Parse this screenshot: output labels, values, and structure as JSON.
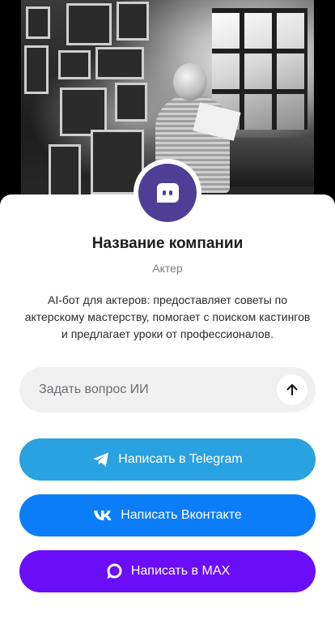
{
  "company": {
    "name": "Название компании",
    "category": "Актер",
    "description": "AI-бот для актеров: предоставляет советы по актерскому мастерству, помогает с поиском кастингов и предлагает уроки от профессионалов."
  },
  "ask": {
    "placeholder": "Задать вопрос ИИ",
    "value": ""
  },
  "buttons": {
    "telegram": "Написать в Telegram",
    "vkontakte": "Написать Вконтакте",
    "max": "Написать в MAX"
  },
  "icons": {
    "avatar": "bot-chat-icon",
    "send": "arrow-up-icon",
    "telegram": "telegram-icon",
    "vkontakte": "vk-icon",
    "max": "max-icon"
  },
  "colors": {
    "avatar": "#4e3e96",
    "telegram": "#2aa1e0",
    "vkontakte": "#0b7df8",
    "max": "#6a0ef8",
    "input_bg": "#f0f0f1"
  }
}
